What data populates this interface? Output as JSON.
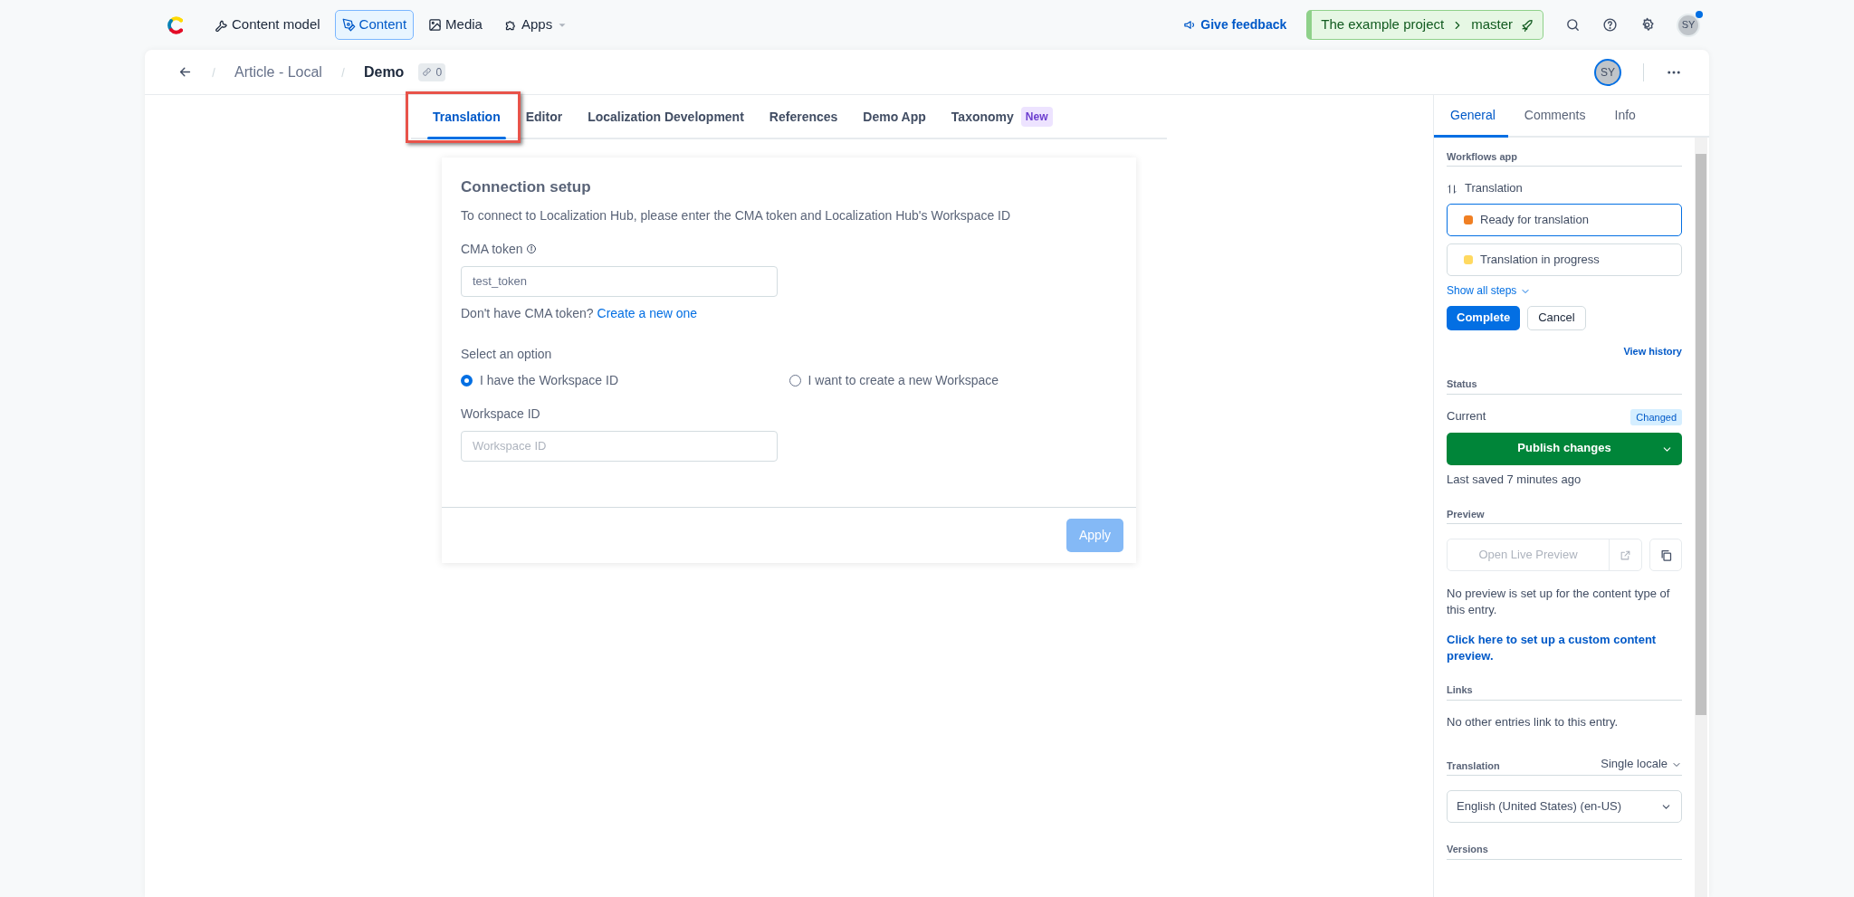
{
  "topbar": {
    "nav": [
      {
        "label": "Content model",
        "selected": false,
        "dropdown": false
      },
      {
        "label": "Content",
        "selected": true,
        "dropdown": false
      },
      {
        "label": "Media",
        "selected": false,
        "dropdown": false
      },
      {
        "label": "Apps",
        "selected": false,
        "dropdown": true
      }
    ],
    "feedback": "Give feedback",
    "project": {
      "name": "The example project",
      "environment": "master"
    },
    "avatar": "SY",
    "notification": true
  },
  "entry": {
    "breadcrumb": [
      "Article - Local"
    ],
    "title": "Demo",
    "links_count": "0",
    "avatar": "SY"
  },
  "tabs": [
    {
      "label": "Translation",
      "selected": true,
      "highlighted": true
    },
    {
      "label": "Editor",
      "selected": false,
      "highlighted": false
    },
    {
      "label": "Localization Development",
      "selected": false,
      "highlighted": false
    },
    {
      "label": "References",
      "selected": false,
      "highlighted": false
    },
    {
      "label": "Demo App",
      "selected": false,
      "highlighted": false
    },
    {
      "label": "Taxonomy",
      "selected": false,
      "highlighted": false,
      "badge": "New"
    }
  ],
  "connection": {
    "title": "Connection setup",
    "description": "To connect to Localization Hub, please enter the CMA token and Localization Hub's Workspace ID",
    "token_label": "CMA token",
    "token_value": "test_token",
    "hint": "Don't have CMA token?",
    "hint_link": "Create a new one",
    "option_label": "Select an option",
    "options": [
      {
        "label": "I have the Workspace ID",
        "selected": true
      },
      {
        "label": "I want to create a new Workspace",
        "selected": false
      }
    ],
    "workspace_label": "Workspace ID",
    "workspace_placeholder": "Workspace ID",
    "apply": "Apply",
    "apply_disabled": true
  },
  "sidebar": {
    "tabs": [
      {
        "label": "General",
        "selected": true
      },
      {
        "label": "Comments",
        "selected": false
      },
      {
        "label": "Info",
        "selected": false
      }
    ],
    "workflow": {
      "heading": "Workflows app",
      "name": "Translation",
      "steps": [
        {
          "label": "Ready for translation",
          "color": "#f07f23",
          "selected": true
        },
        {
          "label": "Translation in progress",
          "color": "#ffd960",
          "selected": false
        }
      ],
      "show_all": "Show all steps",
      "complete": "Complete",
      "cancel": "Cancel",
      "view_history": "View history"
    },
    "status": {
      "heading": "Status",
      "current_label": "Current",
      "badge": "Changed",
      "publish": "Publish changes",
      "last_saved": "Last saved 7 minutes ago"
    },
    "preview": {
      "heading": "Preview",
      "open": "Open Live Preview",
      "open_disabled": true,
      "note": "No preview is set up for the content type of this entry.",
      "link": "Click here to set up a custom content preview."
    },
    "links": {
      "heading": "Links",
      "text": "No other entries link to this entry."
    },
    "translation": {
      "heading": "Translation",
      "mode": "Single locale",
      "locale": "English (United States) (en-US)"
    },
    "versions": {
      "heading": "Versions"
    }
  }
}
